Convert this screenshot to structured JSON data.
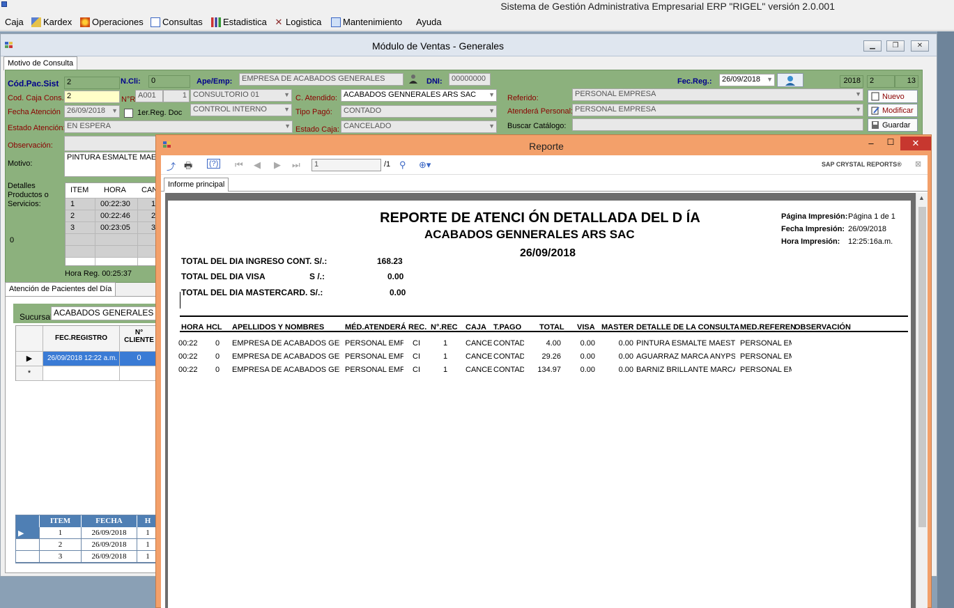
{
  "app": {
    "title": "Sistema de Gestión Administrativa Empresarial ERP  \"RIGEL\" versión 2.0.001",
    "menu": [
      "Caja",
      "Kardex",
      "Operaciones",
      "Consultas",
      "Estadistica",
      "Logistica",
      "Mantenimiento",
      "Ayuda"
    ]
  },
  "ventas": {
    "title": "Módulo de Ventas - Generales",
    "tab_motivo": "Motivo de Consulta",
    "labels": {
      "cod_pac_sist": "Cód.Pac.Sist",
      "n_cli": "N.Cli:",
      "ape_emp": "Ape/Emp:",
      "dni": "DNI:",
      "fec_reg": "Fec.Reg.:",
      "cod_caja_cons": "Cod. Caja Cons.",
      "n_r": "N°R",
      "fecha_atencion": "Fecha Atención",
      "primer_reg_doc": "1er.Reg. Doc",
      "estado_atencion": "Estado Atención:",
      "observacion": "Observación:",
      "motivo": "Motivo:",
      "detalles": "Detalles\nProductos o\nServicios:",
      "c_atendido": "C. Atendido:",
      "tipo_pago": "Tipo Pagó:",
      "estado_caja": "Estado Caja:",
      "referido": "Referido:",
      "atendera_personal": "Atenderá Personal:",
      "buscar_catalogo": "Buscar Catálogo:",
      "zero_left": "0",
      "hora_reg": "Hora Reg.  00:25:37"
    },
    "values": {
      "cod_pac_sist": "2",
      "n_cli": "0",
      "ape_emp": "EMPRESA DE ACABADOS GENERALES",
      "dni": "00000000",
      "fec_reg": "26/09/2018",
      "year": "2018",
      "num_a": "2",
      "num_b": "13",
      "cod_caja_cons": "2",
      "a001": "A001",
      "one": "1",
      "consultorio": "CONSULTORIO 01",
      "control_interno": "CONTROL INTERNO",
      "fecha_atencion": "26/09/2018",
      "estado_atencion": "EN ESPERA",
      "motivo": "PINTURA ESMALTE MAE",
      "c_atendido": "ACABADOS GENNERALES ARS SAC",
      "tipo_pago": "CONTADO",
      "estado_caja": "CANCELADO",
      "referido": "PERSONAL EMPRESA",
      "atendera_personal": "PERSONAL EMPRESA"
    },
    "buttons": {
      "nuevo": "Nuevo",
      "modificar": "Modificar",
      "guardar": "Guardar"
    },
    "prod_grid": {
      "headers": [
        "ITEM",
        "HORA",
        "CAN"
      ],
      "rows": [
        [
          "1",
          "00:22:30",
          "1"
        ],
        [
          "2",
          "00:22:46",
          "2"
        ],
        [
          "3",
          "00:23:05",
          "3"
        ]
      ]
    },
    "tab_atencion": "Atención de Pacientes del Día",
    "sucursal_label": "Sucursal:",
    "sucursal_value": "ACABADOS GENERALES AR",
    "fec_grid": {
      "headers": [
        "FEC.REGISTRO",
        "N°\nCLIENTE"
      ],
      "row": [
        "26/09/2018 12:22 a.m.",
        "0"
      ],
      "new_row_marker": "*"
    },
    "blue_grid": {
      "headers": [
        "ITEM",
        "FECHA",
        "H"
      ],
      "rows": [
        [
          "1",
          "26/09/2018",
          "1"
        ],
        [
          "2",
          "26/09/2018",
          "1"
        ],
        [
          "3",
          "26/09/2018",
          "1"
        ]
      ]
    }
  },
  "reporte": {
    "title": "Reporte",
    "page_input": "1",
    "page_total": "/1",
    "brand": "SAP CRYSTAL REPORTS®",
    "tab": "Informe principal",
    "doc": {
      "title": "REPORTE DE ATENCI ÓN DETALLADA DEL D ÍA",
      "company": "ACABADOS GENNERALES ARS SAC",
      "date": "26/09/2018",
      "meta": [
        {
          "label": "Página Impresión:",
          "value": "Página 1 de 1"
        },
        {
          "label": "Fecha Impresión:",
          "value": "26/09/2018"
        },
        {
          "label": "Hora Impresión:",
          "value": "12:25:16a.m."
        }
      ],
      "totals": [
        {
          "label": "TOTAL DEL DIA INGRESO CONT.  S/.:",
          "value": "168.23"
        },
        {
          "label": "TOTAL DEL DIA VISA",
          "mid": "S  /.:",
          "value": "0.00"
        },
        {
          "label": "TOTAL DEL DIA MASTERCARD.  S/.:",
          "value": "0.00"
        }
      ],
      "columns": [
        "HORA",
        "HCL",
        "APELLIDOS Y NOMBRES",
        "MÉD.ATENDERÁ",
        "REC.",
        "N°.REC",
        "CAJA",
        "T.PAGO",
        "TOTAL",
        "VISA",
        "MASTER",
        "DETALLE DE LA CONSULTA",
        "MED.REFEREN",
        "OBSERVACIÓN"
      ],
      "rows": [
        [
          "00:22",
          "0",
          "EMPRESA DE ACABADOS GEN",
          "PERSONAL EMP",
          "CI",
          "1",
          "CANCE",
          "CONTAD",
          "4.00",
          "0.00",
          "0.00",
          "PINTURA ESMALTE MAESTF",
          "PERSONAL EM"
        ],
        [
          "00:22",
          "0",
          "EMPRESA DE ACABADOS GEN",
          "PERSONAL EMP",
          "CI",
          "1",
          "CANCE",
          "CONTAD",
          "29.26",
          "0.00",
          "0.00",
          "AGUARRAZ MARCA ANYPSA",
          "PERSONAL EM"
        ],
        [
          "00:22",
          "0",
          "EMPRESA DE ACABADOS GEN",
          "PERSONAL EMP",
          "CI",
          "1",
          "CANCE",
          "CONTAD",
          "134.97",
          "0.00",
          "0.00",
          "BARNIZ BRILLANTE MARCA",
          "PERSONAL EM"
        ]
      ]
    }
  }
}
